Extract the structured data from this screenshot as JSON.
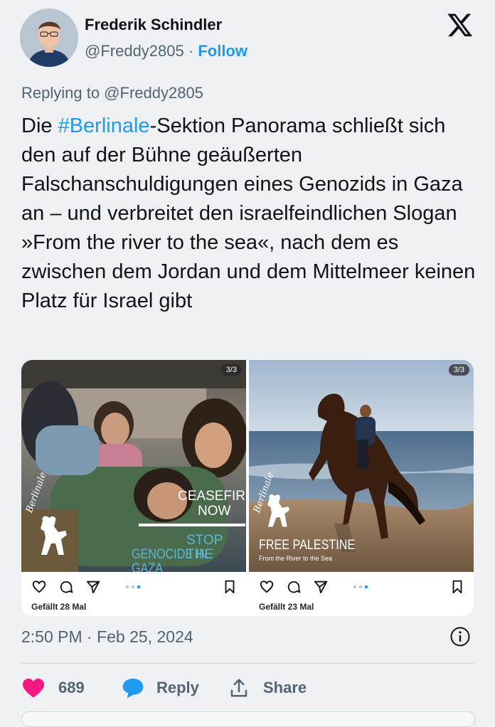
{
  "author": {
    "name": "Frederik Schindler",
    "handle": "@Freddy2805",
    "separator": "·",
    "follow_label": "Follow"
  },
  "replying_to": "Replying to @Freddy2805",
  "tweet": {
    "text_before": "Die ",
    "hashtag": "#Berlinale",
    "text_after": "-Sektion Panorama schließt sich den auf der Bühne geäußerten Falschanschuldigungen eines Genozids in Gaza an – und verbreitet den israelfeindlichen Slogan »From the river to the sea«, nach dem es zwischen dem Jordan und dem Mittelmeer keinen Platz für Israel gibt"
  },
  "media": {
    "left": {
      "badge": "3/3",
      "overlay_line1": "CEASEFIRE",
      "overlay_line2": "NOW",
      "overlay_line3": "STOP THE",
      "overlay_line4": "GENOCIDE IN GAZA",
      "logo_text": "Berlinale",
      "likes": "Gefällt 28 Mal"
    },
    "right": {
      "badge": "3/3",
      "overlay_title": "FREE PALESTINE",
      "overlay_sub": "From the River to the Sea",
      "logo_text": "Berlinale",
      "likes": "Gefällt 23 Mal"
    }
  },
  "timestamp": "2:50 PM · Feb 25, 2024",
  "stats": {
    "likes_count": "689",
    "reply_label": "Reply",
    "share_label": "Share"
  },
  "colors": {
    "accent": "#1d9bf0",
    "heart": "#f91880",
    "muted": "#536471"
  }
}
